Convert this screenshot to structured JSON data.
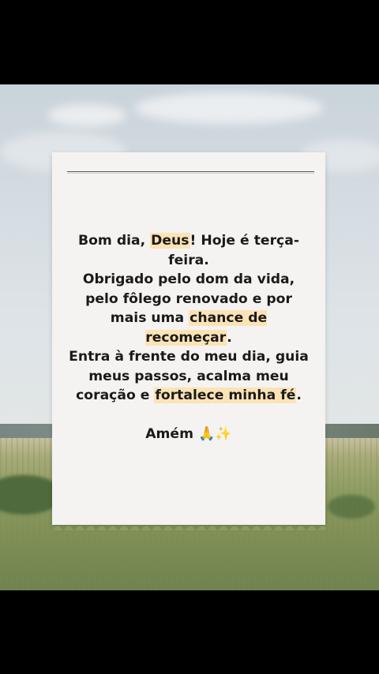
{
  "prayer": {
    "line1_pre": "Bom dia, ",
    "line1_hl": "Deus",
    "line1_post": "! Hoje é terça-feira.",
    "line2": "Obrigado pelo dom da vida, pelo fôlego renovado e por mais uma ",
    "line2_hl": "chance de recomeçar",
    "line2_post": ".",
    "line3": "Entra à frente do meu dia, guia meus passos, acalma meu coração e ",
    "line3_hl": "fortalece minha fé",
    "line3_post": ".",
    "amen": "Amém 🙏✨"
  },
  "colors": {
    "highlight": "#fbe3b6",
    "card": "#f4f3f1",
    "background": "#000000"
  }
}
